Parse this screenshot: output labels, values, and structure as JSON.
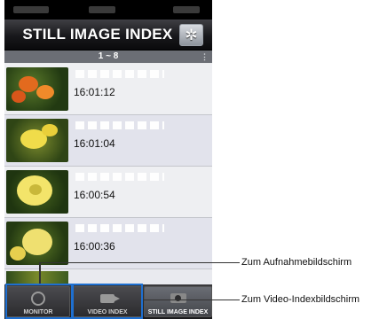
{
  "header": {
    "title": "STILL IMAGE INDEX",
    "settings_icon": "gear-icon"
  },
  "page_range": "1 ~ 8",
  "items": [
    {
      "time": "16:01:12"
    },
    {
      "time": "16:01:04"
    },
    {
      "time": "16:00:54"
    },
    {
      "time": "16:00:36"
    }
  ],
  "tabs": [
    {
      "label": "MONITOR",
      "icon": "monitor-icon"
    },
    {
      "label": "VIDEO INDEX",
      "icon": "video-camera-icon"
    },
    {
      "label": "STILL IMAGE INDEX",
      "icon": "camera-icon",
      "active": true
    }
  ],
  "callouts": [
    {
      "text": "Zum Aufnahmebildschirm"
    },
    {
      "text": "Zum Video-Indexbildschirm"
    }
  ],
  "colors": {
    "highlight": "#1e6fd0",
    "header": "#18181b",
    "row_alt": "#e2e3ec"
  }
}
